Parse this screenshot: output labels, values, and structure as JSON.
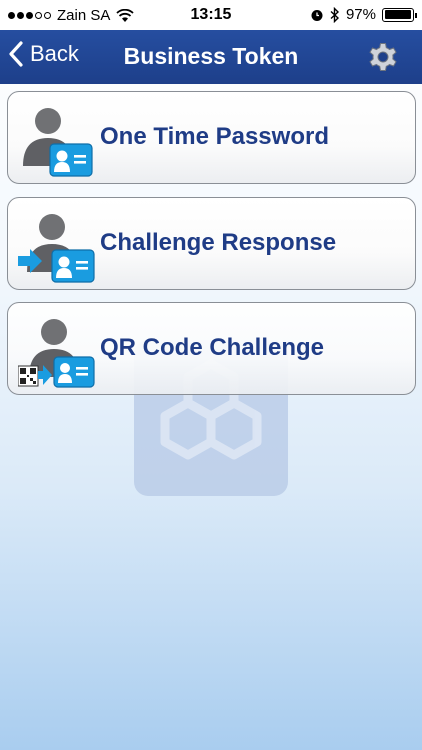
{
  "status_bar": {
    "carrier": "Zain SA",
    "time": "13:15",
    "battery_percent": "97%",
    "battery_level": 0.97,
    "signal_bars_filled": 3,
    "signal_bars_total": 5
  },
  "nav": {
    "back_label": "Back",
    "title": "Business Token",
    "settings_icon": "gear-icon"
  },
  "menu": {
    "items": [
      {
        "label": "One Time Password",
        "icon": "otp-user-card-icon"
      },
      {
        "label": "Challenge Response",
        "icon": "challenge-arrow-user-card-icon"
      },
      {
        "label": "QR Code Challenge",
        "icon": "qr-code-user-card-icon"
      }
    ]
  },
  "colors": {
    "nav_background": "#1d3f8a",
    "label_text": "#1f3c86",
    "accent_blue": "#1a9ce0"
  }
}
